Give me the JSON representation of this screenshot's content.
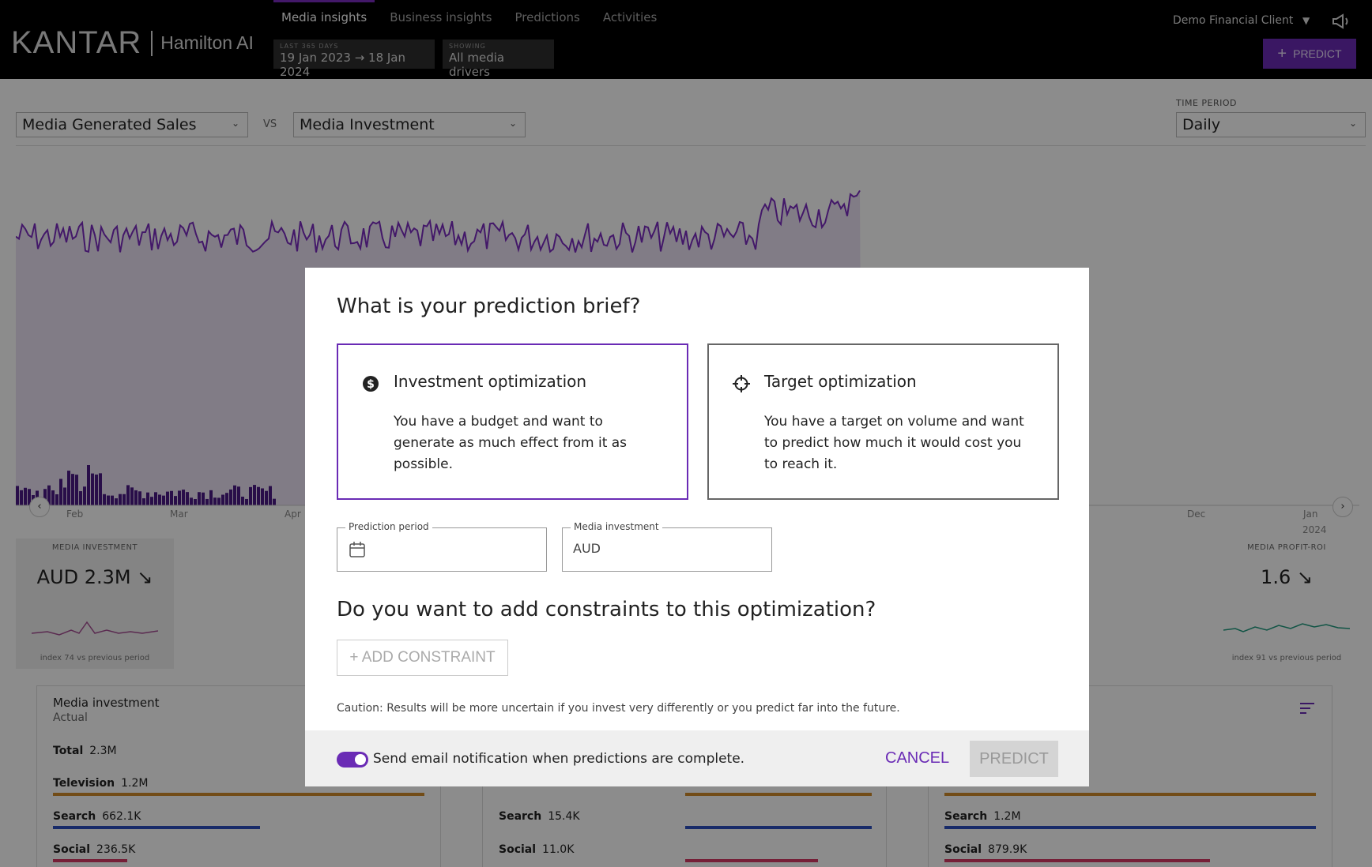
{
  "header": {
    "logo_brand": "KANTAR",
    "logo_product": "Hamilton AI",
    "tabs": [
      {
        "label": "Media insights"
      },
      {
        "label": "Business insights"
      },
      {
        "label": "Predictions"
      },
      {
        "label": "Activities"
      }
    ],
    "range_label": "LAST 365 DAYS",
    "range_value": "19 Jan 2023 → 18 Jan 2024",
    "showing_label": "SHOWING",
    "showing_value": "All media drivers",
    "client": "Demo Financial Client",
    "predict_label": "PREDICT"
  },
  "controls": {
    "metric_a": "Media Generated Sales",
    "vs": "VS",
    "metric_b": "Media Investment",
    "time_period_label": "TIME PERIOD",
    "time_period_value": "Daily"
  },
  "chart": {
    "months": [
      "Feb",
      "Mar",
      "Apr",
      "Dec",
      "Jan"
    ],
    "year": "2024"
  },
  "kpis": {
    "left": {
      "label": "MEDIA INVESTMENT",
      "value": "AUD 2.3M ↘",
      "index": "index 74 vs previous period"
    },
    "right": {
      "label": "MEDIA PROFIT-ROI",
      "value": "1.6 ↘",
      "index": "index 91 vs previous period"
    }
  },
  "panels": {
    "left": {
      "title": "Media investment",
      "subtitle": "Actual",
      "rows": [
        {
          "name": "Total",
          "value": "2.3M"
        },
        {
          "name": "Television",
          "value": "1.2M"
        },
        {
          "name": "Search",
          "value": "662.1K"
        },
        {
          "name": "Social",
          "value": "236.5K"
        }
      ]
    },
    "middle": {
      "rows": [
        {
          "name": "Search",
          "value": "15.4K"
        },
        {
          "name": "Social",
          "value": "11.0K"
        }
      ]
    },
    "right": {
      "rows": [
        {
          "name": "Search",
          "value": "1.2M"
        },
        {
          "name": "Social",
          "value": "879.9K"
        }
      ]
    }
  },
  "colors": {
    "accent": "#6a2bb5",
    "television": "#d08a2a",
    "search": "#2c4fc0",
    "social": "#d63a64"
  },
  "modal": {
    "title": "What is your prediction brief?",
    "options": [
      {
        "title": "Investment optimization",
        "desc": "You have a budget and want to generate as much effect from it as possible.",
        "icon": "dollar-coin-icon",
        "selected": true
      },
      {
        "title": "Target optimization",
        "desc": "You have a target on volume and want to predict how much it would cost you to reach it.",
        "icon": "crosshair-icon",
        "selected": false
      }
    ],
    "period_label": "Prediction period",
    "investment_label": "Media investment",
    "investment_value": "AUD",
    "constraints_title": "Do you want to add constraints to this optimization?",
    "add_constraint": "+ ADD CONSTRAINT",
    "caution": "Caution: Results will be more uncertain if you invest very differently or you predict far into the future.",
    "notify_label": "Send email notification when predictions are complete.",
    "notify_on": true,
    "cancel": "CANCEL",
    "predict": "PREDICT"
  }
}
